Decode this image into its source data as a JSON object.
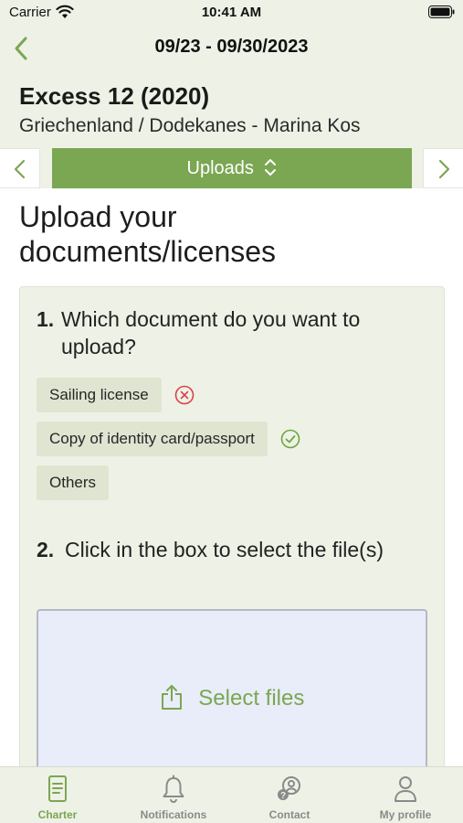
{
  "status_bar": {
    "carrier": "Carrier",
    "time": "10:41 AM"
  },
  "header": {
    "date_range": "09/23 - 09/30/2023",
    "boat_name": "Excess 12 (2020)",
    "location": "Griechenland / Dodekanes - Marina Kos"
  },
  "section_selector": {
    "label": "Uploads"
  },
  "page": {
    "heading": "Upload your documents/licenses"
  },
  "step1": {
    "number": "1.",
    "question": "Which document do you want to upload?",
    "options": [
      {
        "label": "Sailing license",
        "status": "missing"
      },
      {
        "label": "Copy of identity card/passport",
        "status": "uploaded"
      },
      {
        "label": "Others",
        "status": "none"
      }
    ]
  },
  "step2": {
    "number": "2.",
    "instruction": "Click in the box to select the file(s)"
  },
  "dropzone": {
    "label": "Select files"
  },
  "tabs": [
    {
      "label": "Charter",
      "icon": "document-icon",
      "active": true
    },
    {
      "label": "Notifications",
      "icon": "bell-icon",
      "active": false
    },
    {
      "label": "Contact",
      "icon": "support-icon",
      "active": false
    },
    {
      "label": "My profile",
      "icon": "person-icon",
      "active": false
    }
  ],
  "colors": {
    "accent": "#7ba652",
    "background": "#eef1e6",
    "error": "#d9434a",
    "success": "#6da63f"
  }
}
